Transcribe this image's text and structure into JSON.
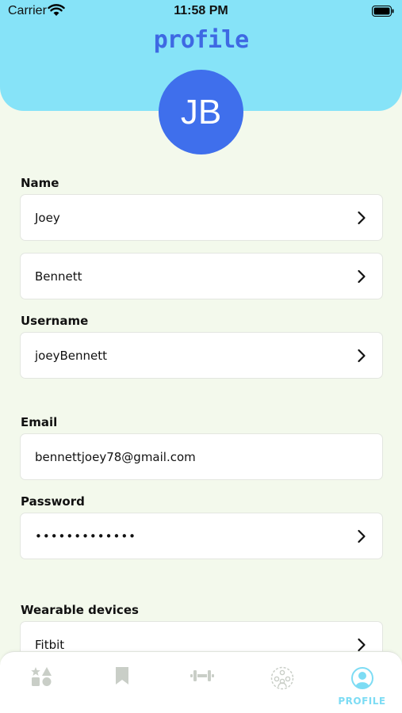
{
  "status_bar": {
    "carrier": "Carrier",
    "time": "11:58 PM"
  },
  "header": {
    "logo_text": "profile",
    "avatar_initials": "JB",
    "color": "#86e3f8"
  },
  "form": {
    "name_label": "Name",
    "first_name": "Joey",
    "last_name": "Bennett",
    "username_label": "Username",
    "username": "joeyBennett",
    "email_label": "Email",
    "email": "bennettjoey78@gmail.com",
    "password_label": "Password",
    "password": "•••••••••••••",
    "wearables_label": "Wearable devices",
    "wearable_device": "Fitbit"
  },
  "tab_bar": {
    "tabs": [
      {
        "icon": "shapes-icon",
        "label": ""
      },
      {
        "icon": "bookmark-icon",
        "label": ""
      },
      {
        "icon": "dumbbell-icon",
        "label": ""
      },
      {
        "icon": "community-icon",
        "label": ""
      },
      {
        "icon": "profile-icon",
        "label": "PROFILE",
        "active": true
      }
    ],
    "active_color": "#7ddcf4",
    "inactive_color": "#c9cec7"
  },
  "colors": {
    "accent": "#3e69e3",
    "avatar": "#3f6fec",
    "background": "#f3f9ec"
  }
}
